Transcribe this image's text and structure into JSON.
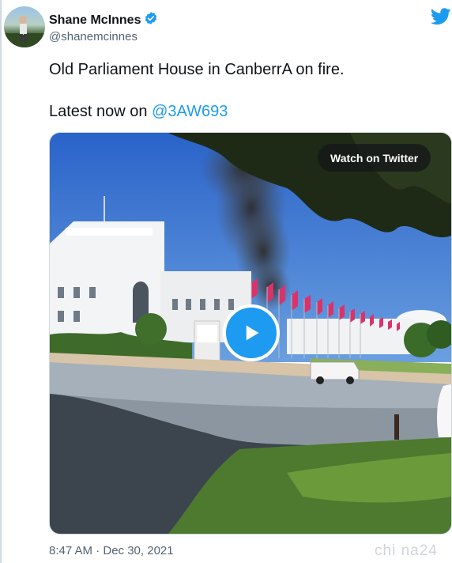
{
  "author": {
    "display_name": "Shane McInnes",
    "handle": "@shanemcinnes",
    "verified": true
  },
  "icons": {
    "verified": "verified-badge-icon",
    "brand": "twitter-bird-icon",
    "play": "play-icon"
  },
  "tweet": {
    "line1": "Old Parliament House in CanberrA on fire.",
    "line2_prefix": "Latest now on ",
    "mention": "@3AW693"
  },
  "media": {
    "watch_label": "Watch on Twitter"
  },
  "timestamp": "8:47 AM · Dec 30, 2021",
  "watermark": "chi na24",
  "colors": {
    "accent": "#1d9bf0",
    "secondary_text": "#536471",
    "border": "#cfd9de"
  }
}
